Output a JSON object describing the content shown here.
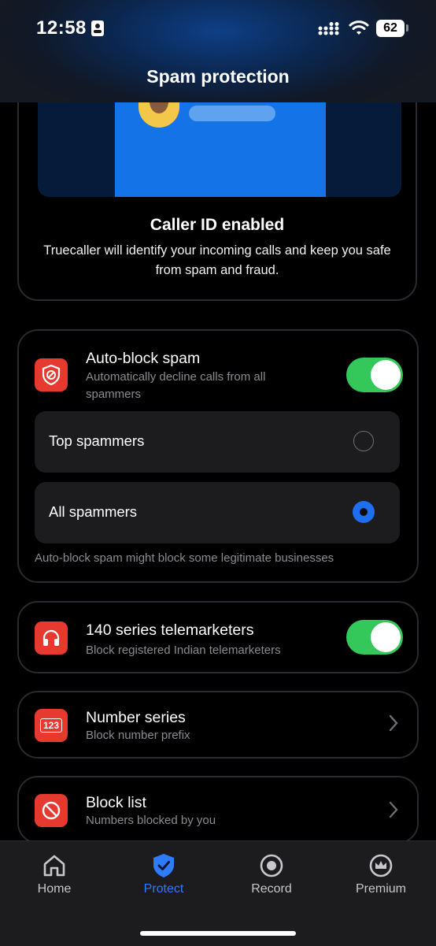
{
  "status_bar": {
    "time": "12:58",
    "battery": "62"
  },
  "header": {
    "title": "Spam protection"
  },
  "caller_id": {
    "title": "Caller ID enabled",
    "description": "Truecaller will identify your incoming calls and keep you safe from spam and fraud."
  },
  "auto_block": {
    "title": "Auto-block spam",
    "subtitle": "Automatically decline calls from all spammers",
    "enabled": true,
    "options": [
      {
        "label": "Top spammers",
        "selected": false
      },
      {
        "label": "All spammers",
        "selected": true
      }
    ],
    "footnote": "Auto-block spam might block some legitimate businesses"
  },
  "telemarketers": {
    "title": "140 series telemarketers",
    "subtitle": "Block registered Indian telemarketers",
    "enabled": true
  },
  "number_series": {
    "title": "Number series",
    "subtitle": "Block number prefix",
    "icon_text": "123"
  },
  "block_list": {
    "title": "Block list",
    "subtitle": "Numbers blocked by you"
  },
  "tabs": [
    {
      "label": "Home",
      "icon": "home-icon"
    },
    {
      "label": "Protect",
      "icon": "shield-check-icon",
      "active": true
    },
    {
      "label": "Record",
      "icon": "record-icon"
    },
    {
      "label": "Premium",
      "icon": "crown-icon"
    }
  ],
  "colors": {
    "accent": "#2f7bff",
    "toggle_on": "#34c759",
    "icon_red": "#e6392f"
  }
}
